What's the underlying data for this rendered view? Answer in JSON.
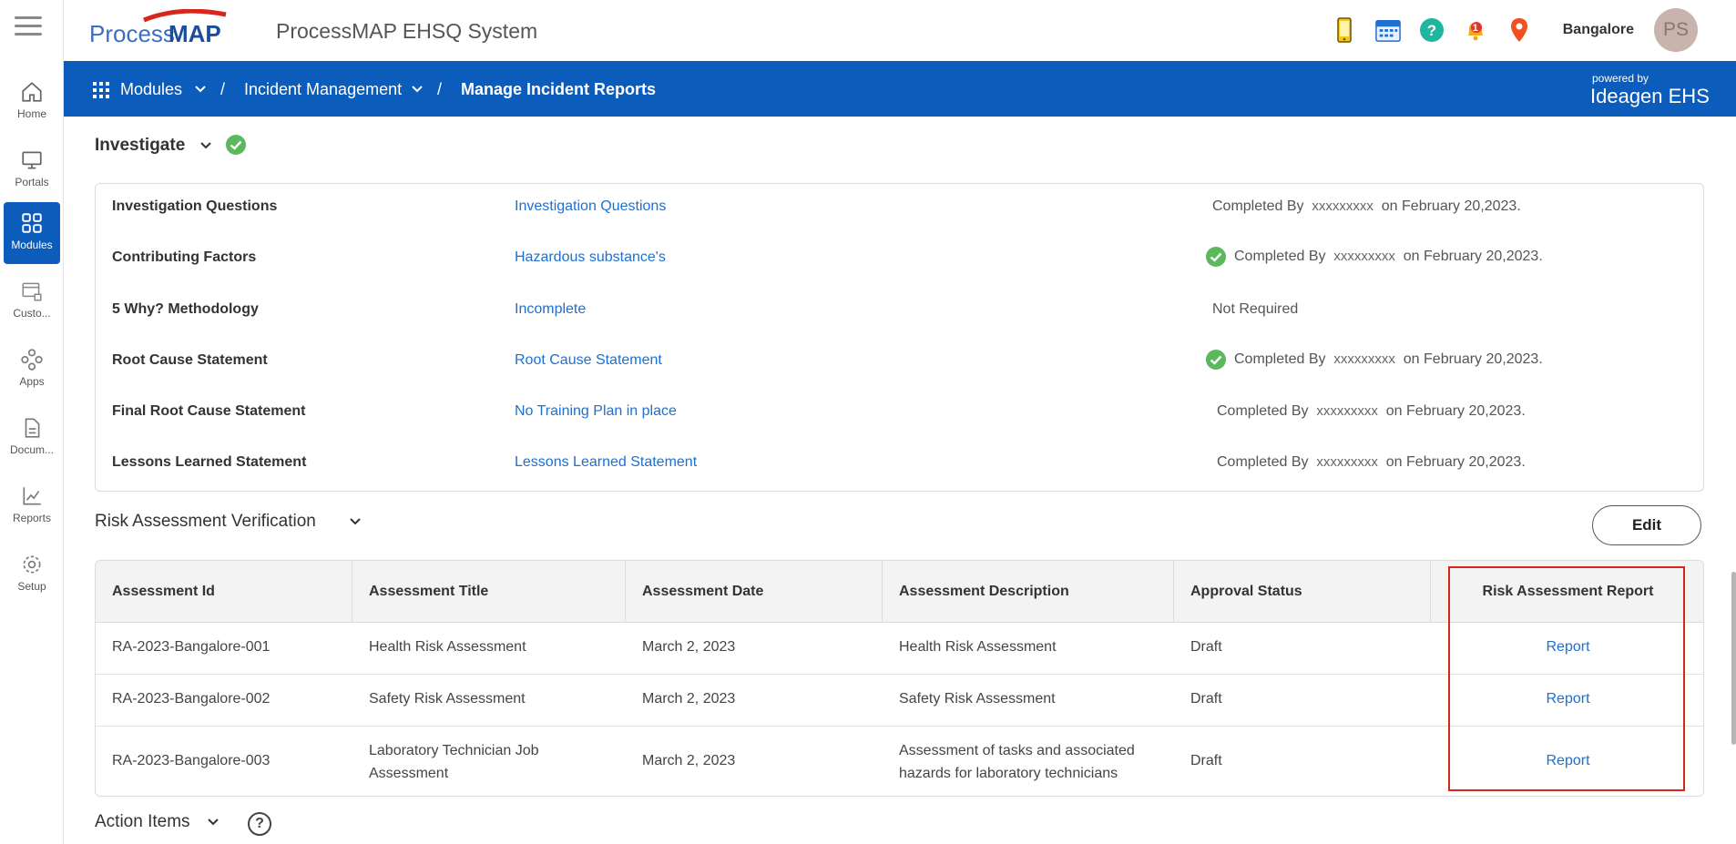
{
  "app": {
    "title": "ProcessMAP EHSQ System",
    "logo_text": "ProcessMAP",
    "powered_by": "powered by",
    "powered_brand": "Ideagen EHS"
  },
  "header": {
    "location": "Bangalore",
    "avatar_initials": "PS",
    "notification_count": "1"
  },
  "sidebar": {
    "items": [
      {
        "label": "Home"
      },
      {
        "label": "Portals"
      },
      {
        "label": "Modules"
      },
      {
        "label": "Custo..."
      },
      {
        "label": "Apps"
      },
      {
        "label": "Docum..."
      },
      {
        "label": "Reports"
      },
      {
        "label": "Setup"
      }
    ]
  },
  "breadcrumb": {
    "modules": "Modules",
    "incident": "Incident Management",
    "current": "Manage Incident Reports",
    "sep": "/"
  },
  "investigate": {
    "title": "Investigate",
    "rows": [
      {
        "label": "Investigation Questions",
        "link": "Investigation Questions",
        "status": "Completed By",
        "user": "xxxxxxxxx",
        "date": "on February 20,2023."
      },
      {
        "label": "Contributing Factors",
        "link": "Hazardous substance's",
        "status": "Completed By",
        "user": "xxxxxxxxx",
        "date": "on February 20,2023."
      },
      {
        "label": "5 Why? Methodology",
        "link": "Incomplete",
        "status": "Not Required",
        "user": "",
        "date": ""
      },
      {
        "label": "Root Cause Statement",
        "link": "Root Cause Statement",
        "status": "Completed By",
        "user": "xxxxxxxxx",
        "date": "on February 20,2023."
      },
      {
        "label": "Final Root Cause Statement",
        "link": "No Training Plan in place",
        "status": "Completed By",
        "user": "xxxxxxxxx",
        "date": "on February 20,2023."
      },
      {
        "label": "Lessons Learned Statement",
        "link": "Lessons Learned Statement",
        "status": "Completed By",
        "user": "xxxxxxxxx",
        "date": "on February 20,2023."
      }
    ]
  },
  "risk": {
    "title": "Risk Assessment Verification",
    "edit_label": "Edit",
    "headers": [
      "Assessment Id",
      "Assessment Title",
      "Assessment Date",
      "Assessment Description",
      "Approval Status",
      "Risk Assessment Report"
    ],
    "rows": [
      {
        "id": "RA-2023-Bangalore-001",
        "title": "Health Risk Assessment",
        "date": "March 2, 2023",
        "description": "Health Risk Assessment",
        "status": "Draft",
        "report": "Report"
      },
      {
        "id": "RA-2023-Bangalore-002",
        "title": "Safety Risk Assessment",
        "date": "March 2, 2023",
        "description": "Safety Risk Assessment",
        "status": "Draft",
        "report": "Report"
      },
      {
        "id": "RA-2023-Bangalore-003",
        "title": "Laboratory Technician Job Assessment",
        "date": "March 2, 2023",
        "description": "Assessment of tasks and associated hazards for laboratory technicians",
        "status": "Draft",
        "report": "Report"
      }
    ]
  },
  "action_items": {
    "title": "Action Items",
    "help": "?"
  },
  "colors": {
    "brand_blue": "#0b5cbb",
    "link_blue": "#1e6fd0",
    "success_green": "#5cb85c",
    "highlight_red": "#d9261c"
  }
}
